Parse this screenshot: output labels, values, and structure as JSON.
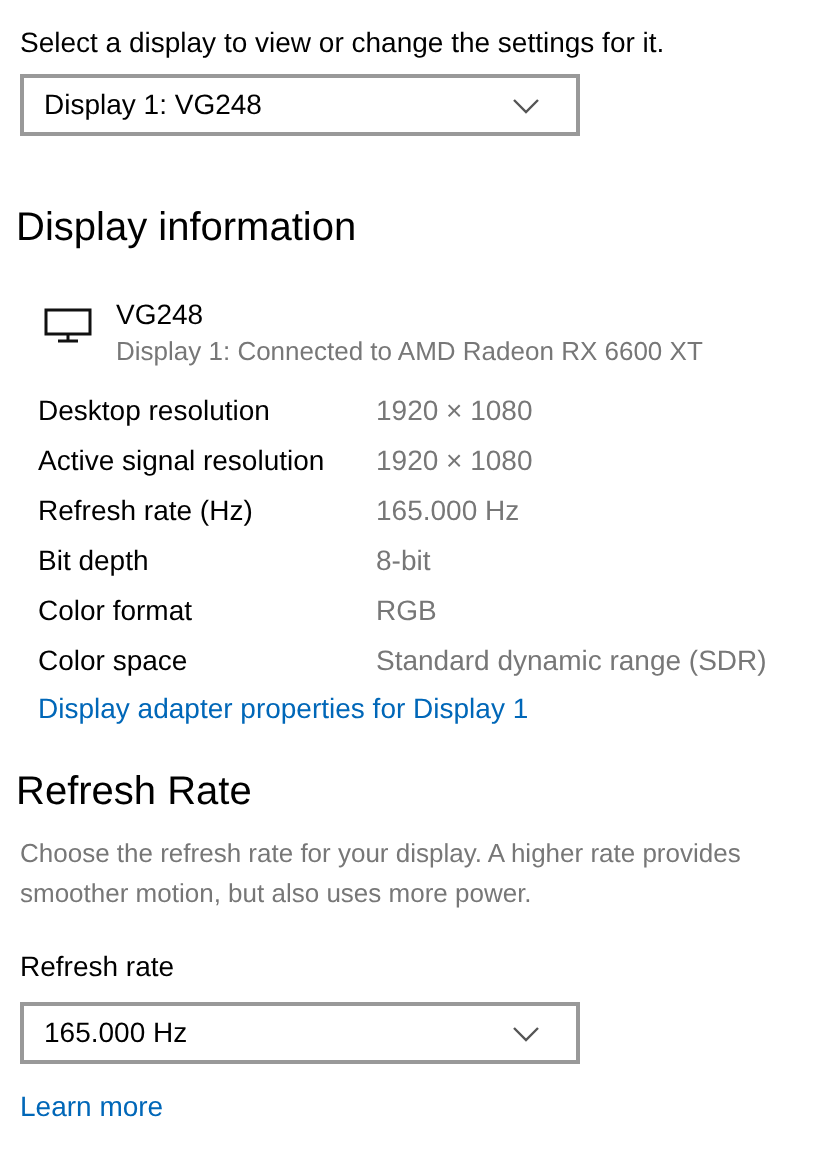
{
  "display_select": {
    "label": "Select a display to view or change the settings for it.",
    "value": "Display 1: VG248"
  },
  "display_information": {
    "heading": "Display information",
    "monitor_name": "VG248",
    "monitor_subtitle": "Display 1: Connected to AMD Radeon RX 6600 XT",
    "rows": [
      {
        "label": "Desktop resolution",
        "value": "1920 × 1080"
      },
      {
        "label": "Active signal resolution",
        "value": "1920 × 1080"
      },
      {
        "label": "Refresh rate (Hz)",
        "value": "165.000 Hz"
      },
      {
        "label": "Bit depth",
        "value": "8-bit"
      },
      {
        "label": "Color format",
        "value": "RGB"
      },
      {
        "label": "Color space",
        "value": "Standard dynamic range (SDR)"
      }
    ],
    "link": "Display adapter properties for Display 1"
  },
  "refresh_rate": {
    "heading": "Refresh Rate",
    "description": "Choose the refresh rate for your display. A higher rate provides smoother motion, but also uses more power.",
    "label": "Refresh rate",
    "value": "165.000 Hz",
    "link": "Learn more"
  }
}
